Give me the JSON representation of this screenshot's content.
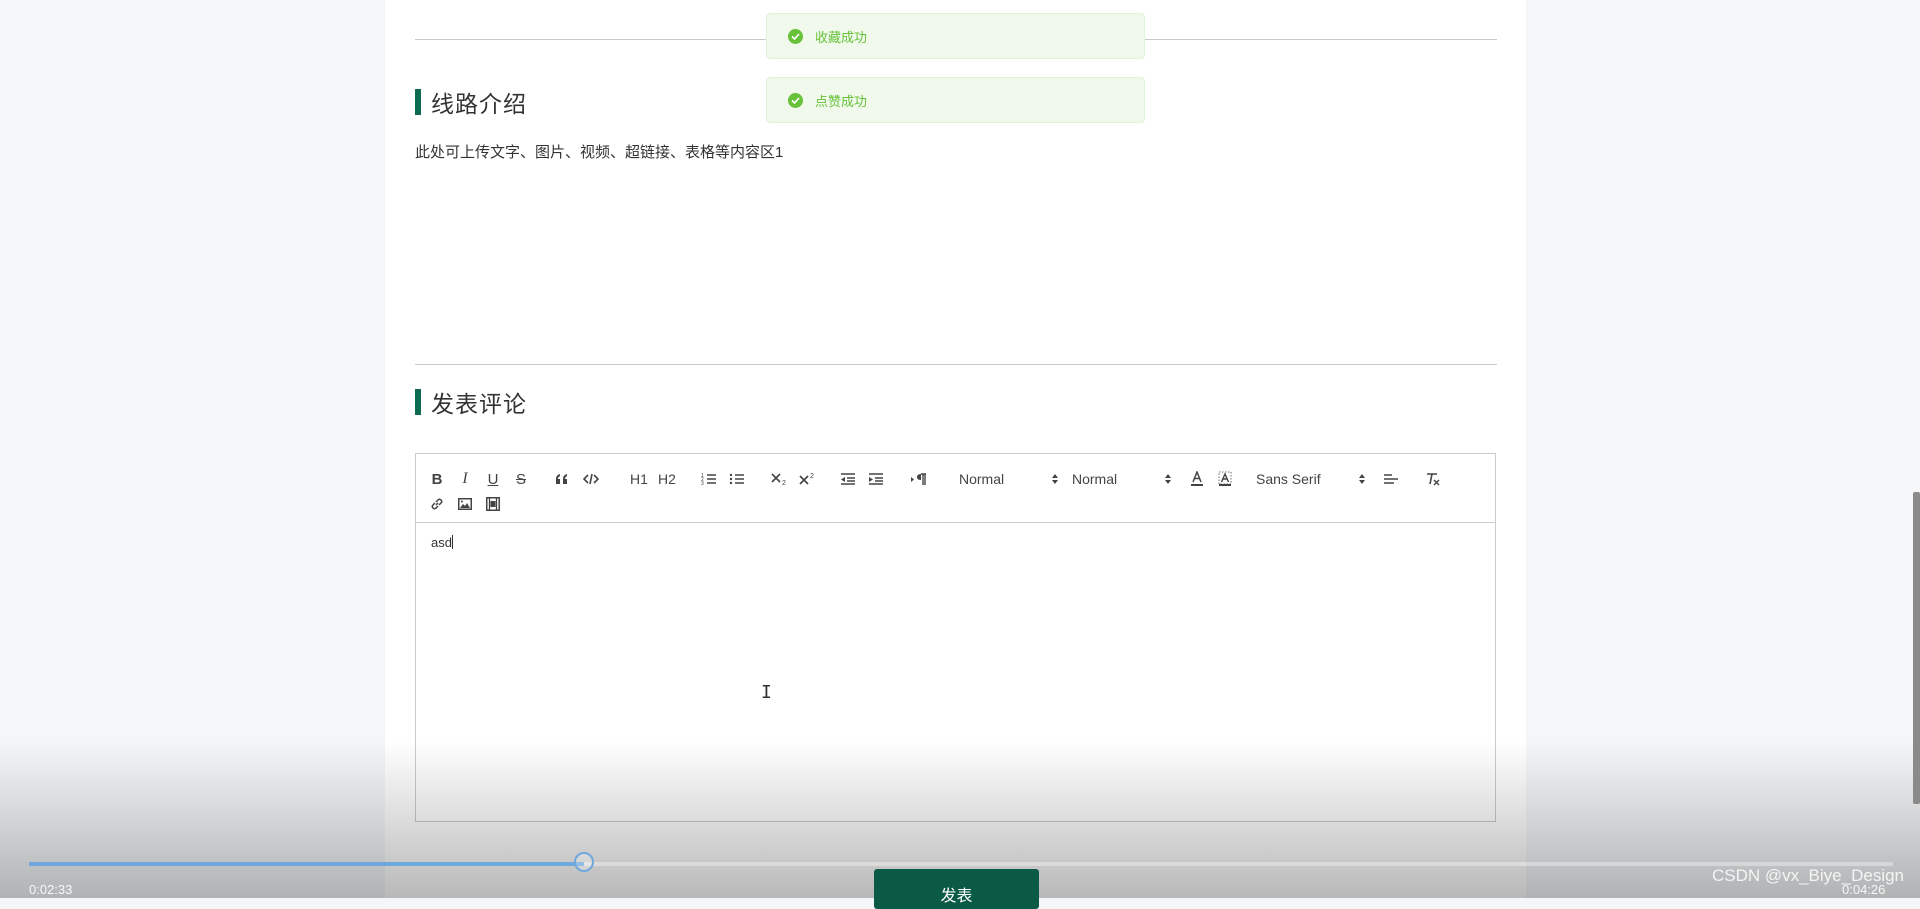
{
  "toasts": {
    "favorite": "收藏成功",
    "like": "点赞成功"
  },
  "route_section": {
    "title": "线路介绍",
    "content": "此处可上传文字、图片、视频、超链接、表格等内容区1"
  },
  "comment_section": {
    "title": "发表评论",
    "editor_text": "asd",
    "submit_label": "发表"
  },
  "toolbar": {
    "bold": "B",
    "italic": "I",
    "underline": "U",
    "strike": "S",
    "header1": "H1",
    "header2": "H2",
    "size_picker": "Normal",
    "header_picker": "Normal",
    "font_picker": "Sans Serif"
  },
  "video_player": {
    "progress": 0.298,
    "current_time": "0:02:33",
    "total_time": "0:04:26"
  },
  "watermark": "CSDN @vx_Biye_Design",
  "colors": {
    "accent": "#0b6b53",
    "button": "#0b5a45",
    "success": "#67c23a",
    "progress": "#6fa8dc"
  }
}
